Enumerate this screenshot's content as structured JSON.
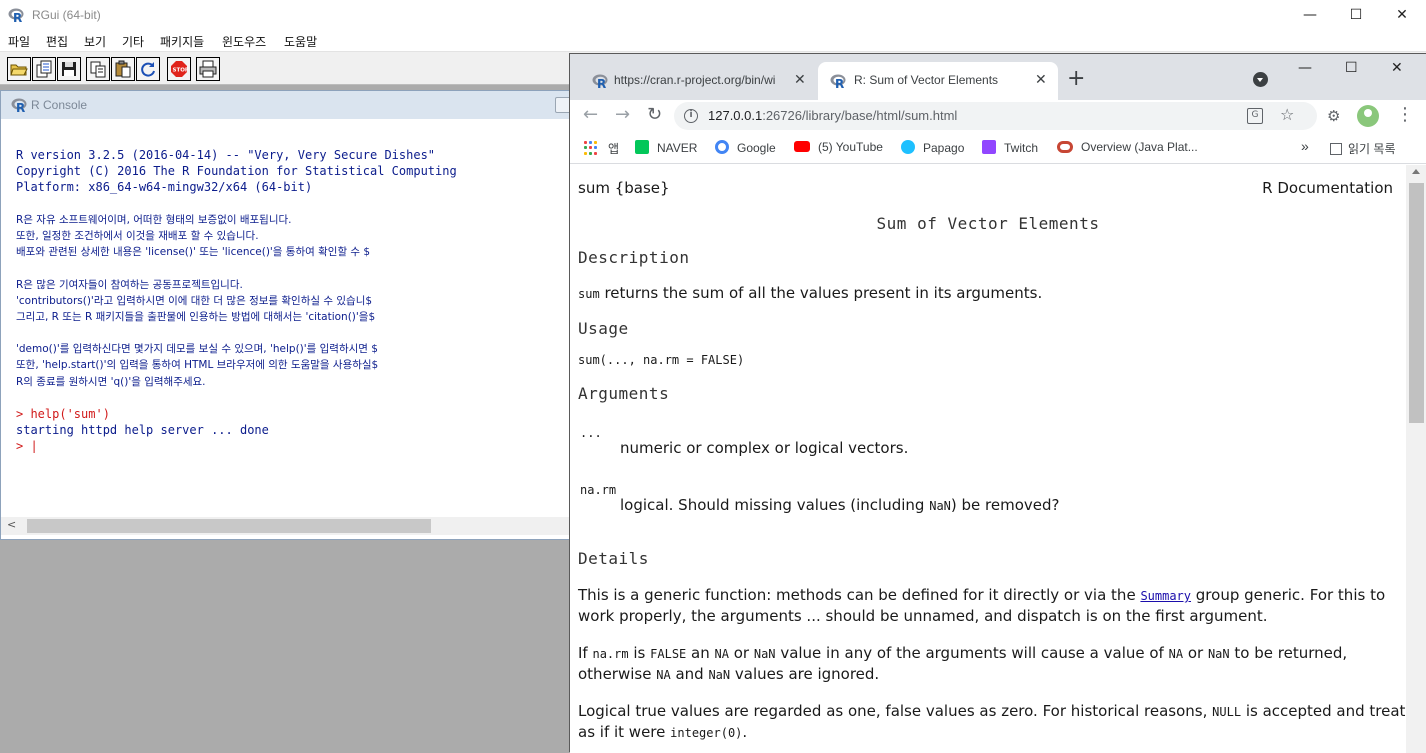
{
  "rgui": {
    "title": "RGui (64-bit)",
    "menu": [
      "파일",
      "편집",
      "보기",
      "기타",
      "패키지들",
      "윈도우즈",
      "도움말"
    ],
    "window_controls": {
      "minimize": "—",
      "maximize": "☐",
      "close": "✕"
    },
    "toolbar": [
      "open-script",
      "load-workspace",
      "save-workspace",
      "copy",
      "paste",
      "copy-paste",
      "stop",
      "print"
    ]
  },
  "console": {
    "title": "R Console",
    "lines": [
      {
        "text": "R version 3.2.5 (2016-04-14) -- \"Very, Very Secure Dishes\"",
        "style": "mono"
      },
      {
        "text": "Copyright (C) 2016 The R Foundation for Statistical Computing",
        "style": "mono"
      },
      {
        "text": "Platform: x86_64-w64-mingw32/x64 (64-bit)",
        "style": "mono"
      },
      {
        "text": "",
        "style": "mono"
      },
      {
        "text": "R은 자유 소프트웨어이며, 어떠한 형태의 보증없이 배포됩니다.",
        "style": "kr"
      },
      {
        "text": "또한, 일정한 조건하에서 이것을 재배포 할 수 있습니다.",
        "style": "kr"
      },
      {
        "text": "배포와 관련된 상세한 내용은 'license()' 또는 'licence()'을 통하여 확인할 수 $",
        "style": "kr"
      },
      {
        "text": "",
        "style": "mono"
      },
      {
        "text": "R은 많은 기여자들이 참여하는 공동프로젝트입니다.",
        "style": "kr"
      },
      {
        "text": "'contributors()'라고 입력하시면 이에 대한 더 많은 정보를 확인하실 수 있습니$",
        "style": "kr"
      },
      {
        "text": "그리고, R 또는 R 패키지들을 출판물에 인용하는 방법에 대해서는 'citation()'을$",
        "style": "kr"
      },
      {
        "text": "",
        "style": "mono"
      },
      {
        "text": "'demo()'를 입력하신다면 몇가지 데모를 보실 수 있으며, 'help()'를 입력하시면 $",
        "style": "kr"
      },
      {
        "text": "또한, 'help.start()'의 입력을 통하여 HTML 브라우저에 의한 도움말을 사용하실$",
        "style": "kr"
      },
      {
        "text": "R의 종료를 원하시면 'q()'을 입력해주세요.",
        "style": "kr"
      },
      {
        "text": "",
        "style": "mono"
      },
      {
        "text": "> help('sum')",
        "style": "red"
      },
      {
        "text": "starting httpd help server ... done",
        "style": "mono"
      },
      {
        "text": "> |",
        "style": "red"
      }
    ]
  },
  "chrome": {
    "tabs": [
      {
        "label": "https://cran.r-project.org/bin/wi",
        "close": "✕"
      },
      {
        "label": "R: Sum of Vector Elements",
        "close": "✕"
      }
    ],
    "new_tab": "+",
    "window_controls": {
      "minimize": "—",
      "maximize": "☐",
      "close": "✕"
    },
    "address": {
      "host": "127.0.0.1",
      "path": ":26726/library/base/html/sum.html"
    },
    "bookmarks": [
      {
        "label": "앱",
        "color": "#ea4335"
      },
      {
        "label": "NAVER",
        "color": "#03c75a"
      },
      {
        "label": "Google",
        "color": "#4285f4"
      },
      {
        "label": "(5) YouTube",
        "color": "#ff0000"
      },
      {
        "label": "Papago",
        "color": "#1ec0ff"
      },
      {
        "label": "Twitch",
        "color": "#9146ff"
      },
      {
        "label": "Overview (Java Plat...",
        "color": "#c74634"
      }
    ],
    "bookmarks_more": "»",
    "reading_list": "읽기 목록"
  },
  "doc": {
    "header_left": "sum {base}",
    "header_right": "R Documentation",
    "title": "Sum of Vector Elements",
    "sections": {
      "description": "Description",
      "usage": "Usage",
      "arguments": "Arguments",
      "details": "Details"
    },
    "description_code": "sum",
    "description_text": " returns the sum of all the values present in its arguments.",
    "usage_code": "sum(..., na.rm = FALSE)",
    "arg1_name": "...",
    "arg1_desc": "numeric or complex or logical vectors.",
    "arg2_name": "na.rm",
    "arg2_desc_a": "logical. Should missing values (including ",
    "arg2_desc_code": "NaN",
    "arg2_desc_b": ") be removed?",
    "details_p1_a": "This is a generic function: methods can be defined for it directly or via the ",
    "details_p1_link": "Summary",
    "details_p1_b": " group generic. For this to",
    "details_p1_c": "work properly, the arguments ... should be unnamed, and dispatch is on the first argument.",
    "details_p2_line1": [
      "If ",
      "na.rm",
      " is ",
      "FALSE",
      " an ",
      "NA",
      " or ",
      "NaN",
      " value in any of the arguments will cause a value of ",
      "NA",
      " or ",
      "NaN",
      " to be returned,"
    ],
    "details_p2_line2": [
      "otherwise ",
      "NA",
      " and ",
      "NaN",
      " values are ignored."
    ],
    "details_p3_line1_a": "Logical true values are regarded as one, false values as zero. For historical reasons, ",
    "details_p3_line1_code": "NULL",
    "details_p3_line1_b": " is accepted and treated",
    "details_p3_line2_a": "as if it were ",
    "details_p3_line2_code": "integer(0)",
    "details_p3_line2_b": "."
  }
}
